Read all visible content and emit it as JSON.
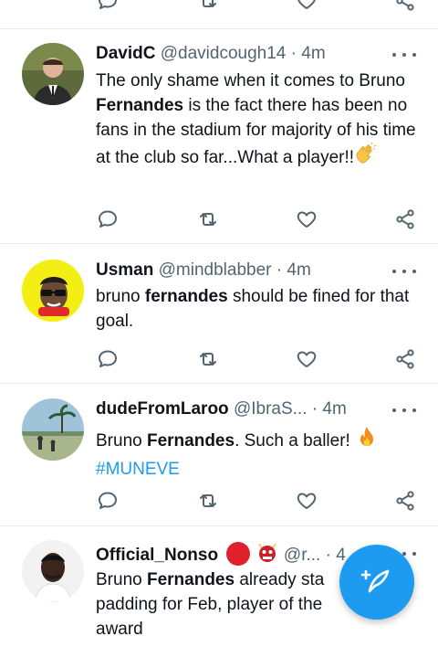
{
  "tweets": [
    {
      "name": "DavidC",
      "handle": "@davidcough14",
      "separator": "·",
      "time": "4m",
      "text_parts": [
        "The only shame when it comes to Bruno ",
        "Fernandes",
        " is the fact there has been no fans in the stadium for majority of his time at the club so far...What a player!!"
      ],
      "emoji": "clapping-hands"
    },
    {
      "name": "Usman",
      "handle": "@mindblabber",
      "separator": "·",
      "time": "4m",
      "text_parts": [
        "bruno ",
        "fernandes",
        " should be fined for that goal."
      ]
    },
    {
      "name": "dudeFromLaroo",
      "handle": "@IbraS...",
      "separator": "·",
      "time": "4m",
      "text_parts": [
        "Bruno ",
        "Fernandes",
        ". Such a baller! "
      ],
      "emoji": "fire",
      "hashtag": "#MUNEVE"
    },
    {
      "name": "Official_Nonso",
      "handle": "@r...",
      "separator": "·",
      "time": "4",
      "text_parts": [
        "Bruno ",
        "Fernandes",
        " already sta",
        "padding for Feb, player of the ",
        "award"
      ]
    }
  ],
  "icons": {
    "reply": "reply-icon",
    "retweet": "retweet-icon",
    "like": "like-icon",
    "share": "share-icon",
    "more": "more-icon",
    "compose": "compose-tweet-icon"
  },
  "colors": {
    "accent": "#1d9bf0",
    "icon_gray": "#536471",
    "divider": "#e6ecf0",
    "text": "#0f1419"
  }
}
